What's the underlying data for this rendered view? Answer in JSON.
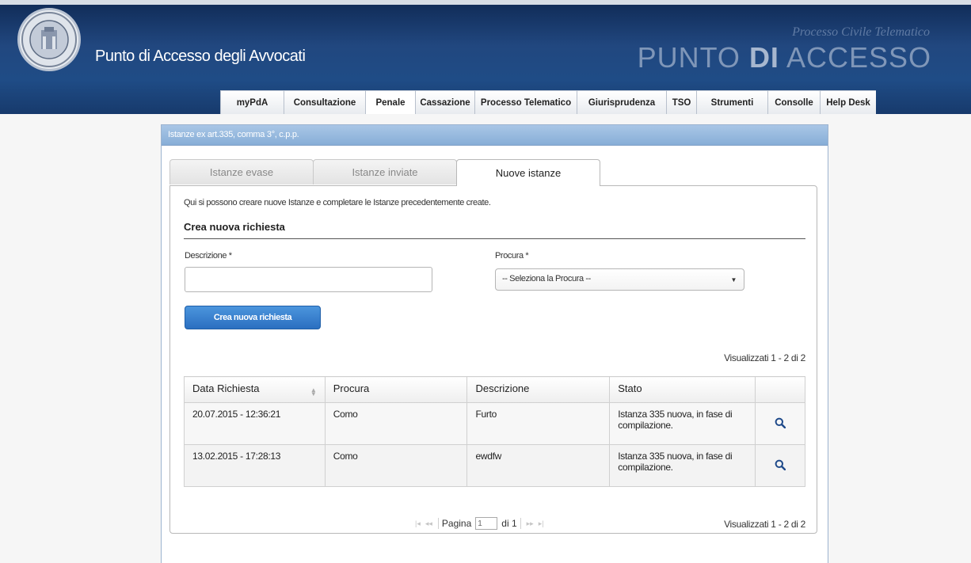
{
  "header": {
    "app_title": "Punto di Accesso degli Avvocati",
    "brand_subtitle": "Processo Civile Telematico",
    "brand_part1": "PUNTO ",
    "brand_part2": "DI",
    "brand_part3": " ACCESSO"
  },
  "nav": {
    "items": [
      {
        "label": "myPdA"
      },
      {
        "label": "Consultazione"
      },
      {
        "label": "Penale"
      },
      {
        "label": "Cassazione"
      },
      {
        "label": "Processo Telematico"
      },
      {
        "label": "Giurisprudenza"
      },
      {
        "label": "TSO"
      },
      {
        "label": "Strumenti"
      },
      {
        "label": "Consolle"
      },
      {
        "label": "Help Desk"
      }
    ],
    "active": "Penale"
  },
  "panel": {
    "title": "Istanze ex art.335, comma 3°, c.p.p."
  },
  "tabs": [
    {
      "label": "Istanze evase"
    },
    {
      "label": "Istanze inviate"
    },
    {
      "label": "Nuove istanze"
    }
  ],
  "form": {
    "intro": "Qui si possono creare nuove Istanze e completare le Istanze precedentemente create.",
    "section_title": "Crea nuova richiesta",
    "descrizione_label": "Descrizione *",
    "descrizione_value": "",
    "procura_label": "Procura *",
    "procura_selected": "-- Seleziona la Procura --",
    "submit_label": "Crea nuova richiesta"
  },
  "table": {
    "count_top": "Visualizzati 1 - 2 di 2",
    "count_bottom": "Visualizzati 1 - 2 di 2",
    "columns": [
      "Data Richiesta",
      "Procura",
      "Descrizione",
      "Stato"
    ],
    "rows": [
      {
        "data": "20.07.2015 - 12:36:21",
        "procura": "Como",
        "descrizione": "Furto",
        "stato": "Istanza 335 nuova, in fase di compilazione."
      },
      {
        "data": "13.02.2015 - 17:28:13",
        "procura": "Como",
        "descrizione": "ewdfw",
        "stato": "Istanza 335 nuova, in fase di compilazione."
      }
    ]
  },
  "pager": {
    "page_label": "Pagina",
    "page_value": "1",
    "of_label": "di 1"
  },
  "icons": {
    "seal": "university-seal-icon",
    "view": "magnifier-icon",
    "sort": "sort-icon",
    "caret": "chevron-down-icon"
  },
  "colors": {
    "header_bg": "#1f4c86",
    "panel_header": "#95b8de",
    "button_blue": "#2b6fc0",
    "icon_blue": "#1f4a8a"
  }
}
